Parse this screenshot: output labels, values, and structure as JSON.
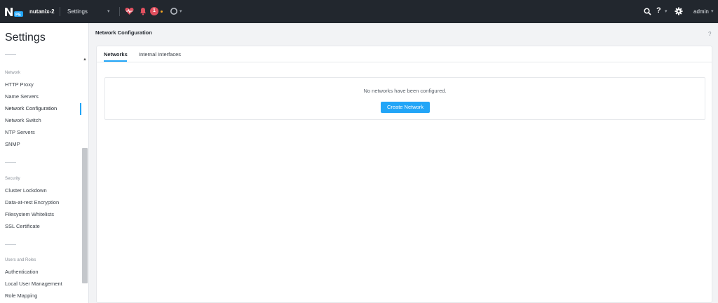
{
  "topbar": {
    "cluster_name": "nutanix-2",
    "app_selector": "Settings",
    "alert_count": "1",
    "user": "admin",
    "help_label": "?"
  },
  "sidebar": {
    "title": "Settings",
    "sections": [
      {
        "label": "Network",
        "items": [
          "HTTP Proxy",
          "Name Servers",
          "Network Configuration",
          "Network Switch",
          "NTP Servers",
          "SNMP"
        ]
      },
      {
        "label": "Security",
        "items": [
          "Cluster Lockdown",
          "Data-at-rest Encryption",
          "Filesystem Whitelists",
          "SSL Certificate"
        ]
      },
      {
        "label": "Users and Roles",
        "items": [
          "Authentication",
          "Local User Management",
          "Role Mapping"
        ]
      }
    ],
    "active_item": "Network Configuration"
  },
  "main": {
    "title": "Network Configuration",
    "help_label": "?",
    "tabs": [
      {
        "label": "Networks",
        "active": true
      },
      {
        "label": "Internal Interfaces",
        "active": false
      }
    ],
    "empty_message": "No networks have been configured.",
    "create_button": "Create Network"
  },
  "colors": {
    "topbar_bg": "#22272e",
    "accent": "#22a5f7",
    "alert": "#e0505f",
    "page_bg": "#f2f3f5"
  },
  "icons": [
    "nutanix-logo",
    "health-heart-icon",
    "alerts-bell-icon",
    "tasks-circle-icon",
    "search-icon",
    "help-icon",
    "gear-icon"
  ]
}
